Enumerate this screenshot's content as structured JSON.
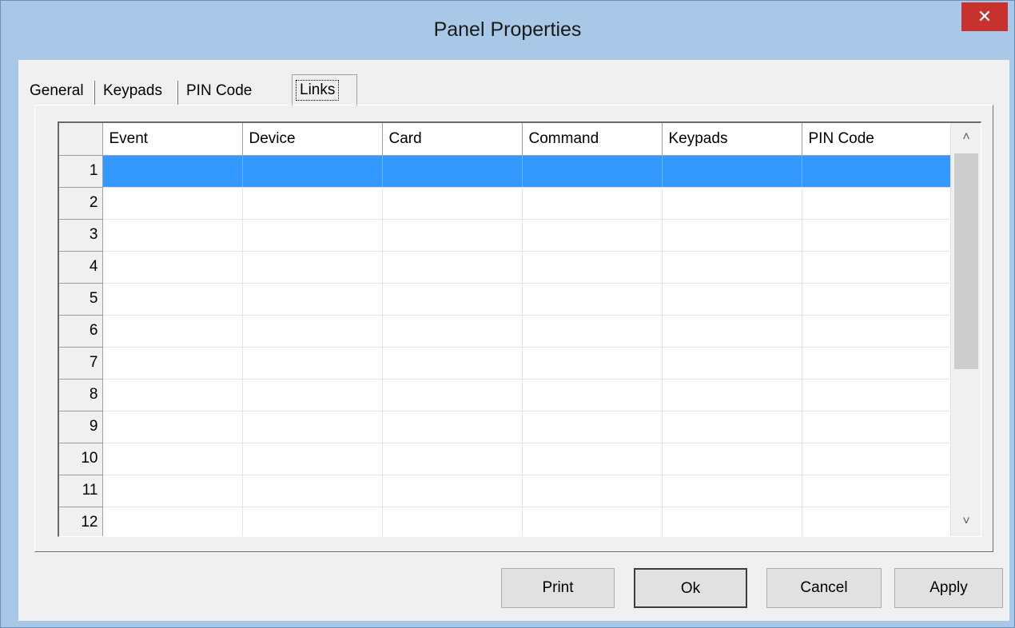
{
  "window": {
    "title": "Panel Properties",
    "close_glyph": "✕"
  },
  "tabs": [
    {
      "label": "General",
      "active": false
    },
    {
      "label": "Keypads",
      "active": false
    },
    {
      "label": "PIN Code",
      "active": false
    },
    {
      "label": "Links",
      "active": true
    }
  ],
  "grid": {
    "columns": [
      "Event",
      "Device",
      "Card",
      "Command",
      "Keypads",
      "PIN Code"
    ],
    "rows": [
      "1",
      "2",
      "3",
      "4",
      "5",
      "6",
      "7",
      "8",
      "9",
      "10",
      "11",
      "12"
    ],
    "selected_row": "1",
    "colors": {
      "selection": "#3399ff"
    }
  },
  "scrollbar": {
    "up_icon": "up-arrow-icon",
    "down_icon": "down-arrow-icon",
    "up_glyph": "˄",
    "down_glyph": "˅"
  },
  "buttons": {
    "print": "Print",
    "ok": "Ok",
    "cancel": "Cancel",
    "apply": "Apply"
  }
}
